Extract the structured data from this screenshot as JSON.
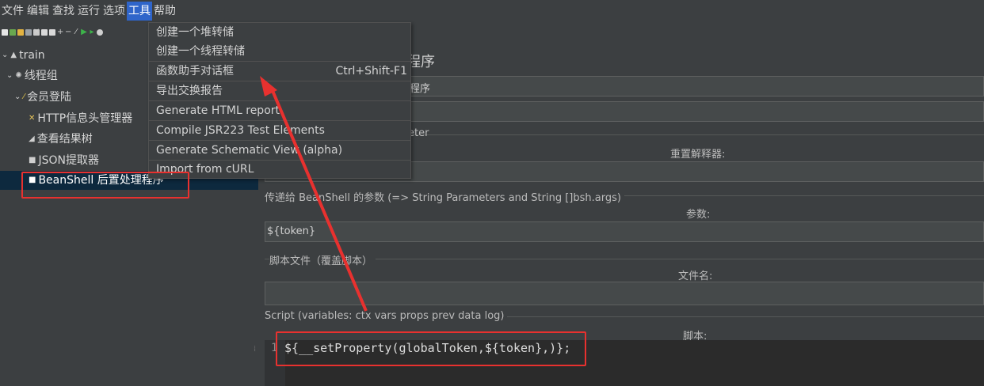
{
  "menubar": {
    "items": [
      "文件",
      "编辑",
      "查找",
      "运行",
      "选项",
      "工具",
      "帮助"
    ],
    "active_index": 5
  },
  "tools_menu": {
    "items": [
      {
        "label": "创建一个堆转储",
        "shortcut": ""
      },
      {
        "label": "创建一个线程转储",
        "shortcut": ""
      },
      {
        "label": "函数助手对话框",
        "shortcut": "Ctrl+Shift-F1"
      },
      {
        "label": "导出交换报告",
        "shortcut": ""
      },
      {
        "label": "Generate HTML report",
        "shortcut": ""
      },
      {
        "label": "Compile JSR223 Test Elements",
        "shortcut": ""
      },
      {
        "label": "Generate Schematic View (alpha)",
        "shortcut": ""
      },
      {
        "label": "Import from cURL",
        "shortcut": ""
      }
    ]
  },
  "tree": {
    "items": [
      {
        "label": "train",
        "icon": "test-plan-icon",
        "expander": "⌄"
      },
      {
        "label": "线程组",
        "icon": "gear-icon",
        "expander": "⌄"
      },
      {
        "label": "会员登陆",
        "icon": "sampler-icon",
        "expander": "⌄"
      },
      {
        "label": "HTTP信息头管理器",
        "icon": "config-icon",
        "expander": ""
      },
      {
        "label": "查看结果树",
        "icon": "listener-icon",
        "expander": ""
      },
      {
        "label": "JSON提取器",
        "icon": "post-processor-icon",
        "expander": ""
      },
      {
        "label": "BeanShell 后置处理程序",
        "icon": "post-processor-icon",
        "expander": ""
      }
    ],
    "selected_index": 6
  },
  "panel": {
    "title_partial": "程序",
    "name_partial": "程序",
    "interpreter_partial": "reter",
    "reset_interpreter_label": "重置解释器:",
    "params_section": "传递给 BeanShell 的参数 (=> String Parameters and String []bsh.args)",
    "params_label": "参数:",
    "params_value": "${token}",
    "script_file_section": "脚本文件（覆盖脚本）",
    "filename_label": "文件名:",
    "script_section": "Script (variables: ctx vars props prev data log)",
    "script_label": "脚本:",
    "script_line_number": "1",
    "script_code": "${__setProperty(globalToken,${token},)};"
  },
  "colors": {
    "annotation_red": "#e8312f",
    "menu_active": "#2f65ca",
    "tree_selected": "#0d293e"
  }
}
